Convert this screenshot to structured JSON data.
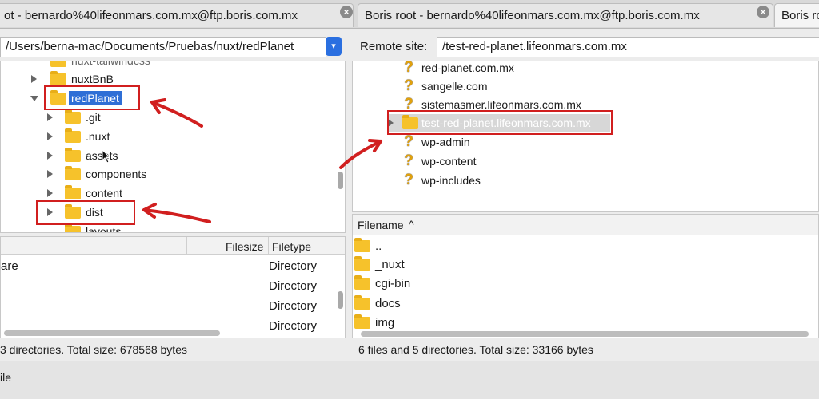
{
  "tabs": [
    {
      "label": "ot - bernardo%40lifeonmars.com.mx@ftp.boris.com.mx",
      "close": "×"
    },
    {
      "label": "Boris root - bernardo%40lifeonmars.com.mx@ftp.boris.com.mx",
      "close": "×"
    },
    {
      "label": "Boris ro"
    }
  ],
  "local": {
    "path": "/Users/berna-mac/Documents/Pruebas/nuxt/redPlanet",
    "tree": [
      {
        "label": "nuxt-tailwindcss"
      },
      {
        "label": "nuxtBnB"
      },
      {
        "label": "redPlanet"
      },
      {
        "label": ".git"
      },
      {
        "label": ".nuxt"
      },
      {
        "label": "assets"
      },
      {
        "label": "components"
      },
      {
        "label": "content"
      },
      {
        "label": "dist"
      },
      {
        "label": "layouts"
      }
    ],
    "columns": {
      "filesize": "Filesize",
      "filetype": "Filetype"
    },
    "files": [
      {
        "name": "are",
        "type": "Directory"
      },
      {
        "name": "",
        "type": "Directory"
      },
      {
        "name": "",
        "type": "Directory"
      },
      {
        "name": "",
        "type": "Directory"
      }
    ],
    "status": "3 directories. Total size: 678568 bytes"
  },
  "remote": {
    "label": "Remote site:",
    "path": "/test-red-planet.lifeonmars.com.mx",
    "tree": [
      {
        "label": "red-planet.com.mx",
        "icon": "question-folder-icon"
      },
      {
        "label": "sangelle.com",
        "icon": "question-folder-icon"
      },
      {
        "label": "sistemasmer.lifeonmars.com.mx",
        "icon": "question-folder-icon"
      },
      {
        "label": "test-red-planet.lifeonmars.com.mx",
        "icon": "folder-icon"
      },
      {
        "label": "wp-admin",
        "icon": "question-folder-icon"
      },
      {
        "label": "wp-content",
        "icon": "question-folder-icon"
      },
      {
        "label": "wp-includes",
        "icon": "question-folder-icon"
      }
    ],
    "columns": {
      "filename": "Filename",
      "sort": "^"
    },
    "files": [
      {
        "name": ".."
      },
      {
        "name": "_nuxt"
      },
      {
        "name": "cgi-bin"
      },
      {
        "name": "docs"
      },
      {
        "name": "img"
      }
    ],
    "status": "6 files and 5 directories. Total size: 33166 bytes"
  },
  "bottom": {
    "label": "ile"
  },
  "colors": {
    "annotation": "#d11f1f",
    "selection": "#2f6fd6",
    "folder": "#f6c22b"
  }
}
